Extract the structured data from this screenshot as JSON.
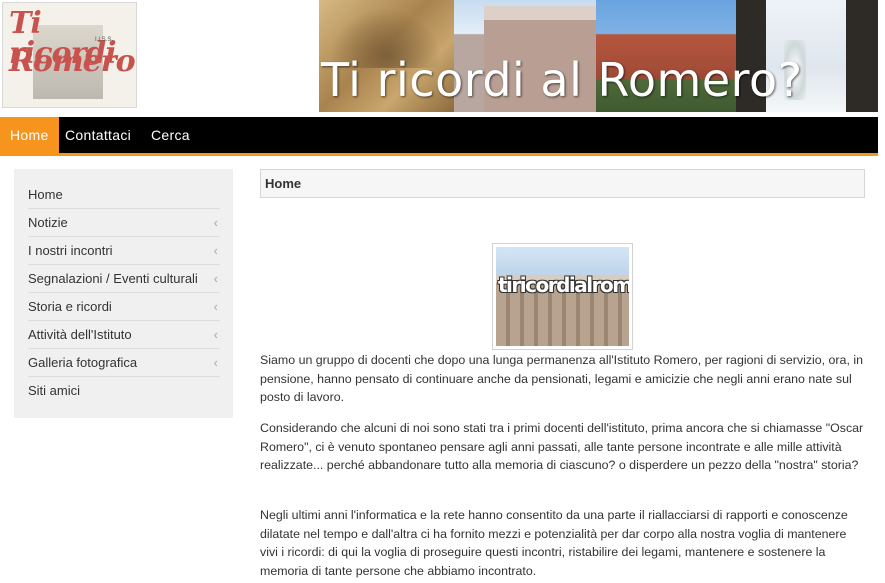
{
  "header": {
    "logo_line1": "Ti ricordi",
    "logo_line2": "Romero?",
    "logo_small": "I.I.S.S.",
    "banner_title": "Ti ricordi al Romero?"
  },
  "nav": {
    "items": [
      {
        "label": "Home",
        "active": true
      },
      {
        "label": "Contattaci",
        "active": false
      },
      {
        "label": "Cerca",
        "active": false
      }
    ]
  },
  "sidebar": {
    "items": [
      {
        "label": "Home",
        "has_submenu": false
      },
      {
        "label": "Notizie",
        "has_submenu": true
      },
      {
        "label": "I nostri incontri",
        "has_submenu": true
      },
      {
        "label": "Segnalazioni / Eventi culturali",
        "has_submenu": true
      },
      {
        "label": "Storia e ricordi",
        "has_submenu": true
      },
      {
        "label": "Attività dell'Istituto",
        "has_submenu": true
      },
      {
        "label": "Galleria fotografica",
        "has_submenu": true
      },
      {
        "label": "Siti amici",
        "has_submenu": false
      }
    ],
    "chevron": "‹"
  },
  "main": {
    "title": "Home",
    "image_text": "tiricordialromero",
    "paragraphs": [
      "Siamo un gruppo di docenti che dopo una lunga permanenza all'Istituto Romero, per ragioni di servizio, ora, in pensione, hanno pensato di continuare anche da pensionati, legami e amicizie che negli anni erano nate sul posto di lavoro.",
      "Considerando che alcuni di noi sono stati tra i primi docenti dell'istituto, prima ancora che si chiamasse \"Oscar Romero\", ci è venuto spontaneo pensare agli anni passati, alle tante persone incontrate e alle mille attività realizzate... perché abbandonare tutto alla memoria di ciascuno? o disperdere un pezzo della \"nostra\" storia?",
      "Negli ultimi anni l'informatica e la rete hanno consentito da una parte il riallacciarsi di rapporti e conoscenze dilatate nel tempo e dall'altra ci ha fornito mezzi e potenzialità per dar corpo alla nostra voglia di mantenere vivi i ricordi: di qui la voglia di proseguire questi incontri, ristabilire dei legami, mantenere e sostenere la memoria di tante persone che abbiamo incontrato."
    ]
  },
  "colors": {
    "accent": "#f7941d",
    "nav_bg": "#000000",
    "sidebar_bg": "#f0f0f0"
  }
}
